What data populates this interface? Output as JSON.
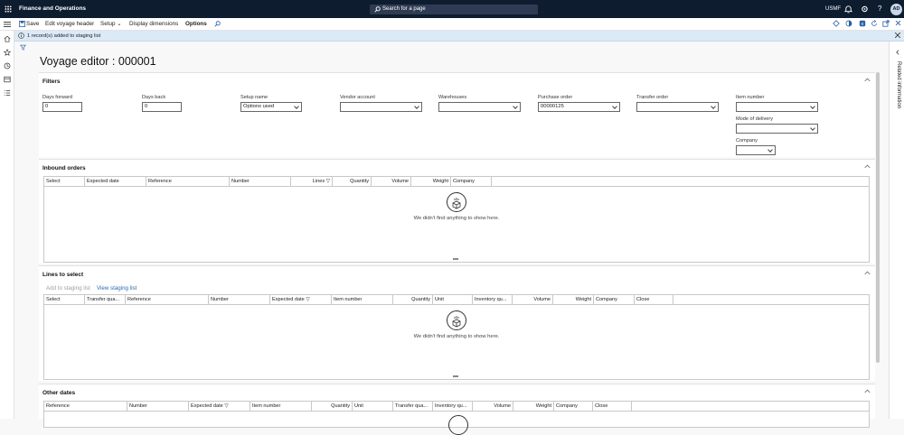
{
  "topbar": {
    "app_name": "Finance and Operations",
    "search_placeholder": "Search for a page",
    "company": "USMF",
    "avatar_initials": "AD"
  },
  "actionbar": {
    "save": "Save",
    "edit_voyage_header": "Edit voyage header",
    "setup": "Setup",
    "display_dimensions": "Display dimensions",
    "options": "Options"
  },
  "info": {
    "message": "1 record(s) added to staging list"
  },
  "page": {
    "title": "Voyage editor : 000001"
  },
  "right_pane": {
    "label": "Related information"
  },
  "filters": {
    "title": "Filters",
    "days_forward": {
      "label": "Days forward",
      "value": "0"
    },
    "days_back": {
      "label": "Days back",
      "value": "0"
    },
    "setup_name": {
      "label": "Setup name",
      "value": "Options used"
    },
    "vendor_account": {
      "label": "Vendor account",
      "value": ""
    },
    "warehouses": {
      "label": "Warehouses",
      "value": ""
    },
    "purchase_order": {
      "label": "Purchase order",
      "value": "00000125"
    },
    "transfer_order": {
      "label": "Transfer order",
      "value": ""
    },
    "item_number": {
      "label": "Item number",
      "value": ""
    },
    "mode_of_delivery": {
      "label": "Mode of delivery",
      "value": ""
    },
    "company": {
      "label": "Company",
      "value": ""
    }
  },
  "inbound_orders": {
    "title": "Inbound orders",
    "columns": [
      "Select",
      "Expected date",
      "Reference",
      "Number",
      "Lines",
      "Quantity",
      "Volume",
      "Weight",
      "Company"
    ],
    "empty_text": "We didn't find anything to show here."
  },
  "lines_to_select": {
    "title": "Lines to select",
    "add_to_staging": "Add to staging list",
    "view_staging": "View staging list",
    "columns": [
      "Select",
      "Transfer qua...",
      "Reference",
      "Number",
      "Expected date",
      "Item number",
      "Quantity",
      "Unit",
      "Inventory qu...",
      "Volume",
      "Weight",
      "Company",
      "Close"
    ],
    "empty_text": "We didn't find anything to show here."
  },
  "other_dates": {
    "title": "Other dates",
    "columns": [
      "Reference",
      "Number",
      "Expected date",
      "Item number",
      "Quantity",
      "Unit",
      "Transfer qua...",
      "Inventory qu...",
      "Volume",
      "Weight",
      "Company",
      "Close"
    ]
  }
}
